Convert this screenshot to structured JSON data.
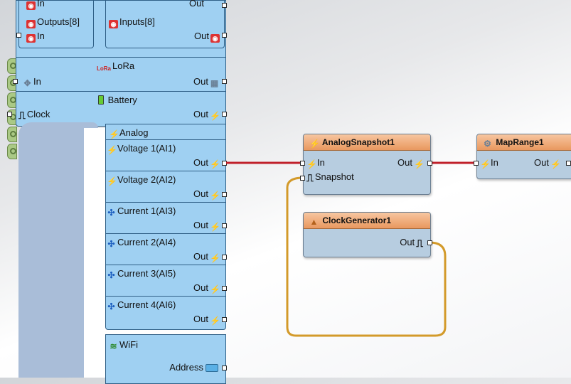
{
  "board": {
    "top_partial_left": "In",
    "top_partial_right": "Out",
    "outputs_label": "Outputs[8]",
    "outputs_in": "In",
    "inputs_label": "Inputs[8]",
    "inputs_out": "Out",
    "lora_label": "LoRa",
    "lora_icon_text": "LoRa",
    "lora_in": "In",
    "lora_out": "Out",
    "battery_label": "Battery",
    "clock_label": "Clock",
    "battery_out": "Out",
    "analog_label": "Analog",
    "analog_channels": [
      {
        "label": "Voltage 1(AI1)",
        "out": "Out",
        "icon": "voltage-icon"
      },
      {
        "label": "Voltage 2(AI2)",
        "out": "Out",
        "icon": "voltage-icon"
      },
      {
        "label": "Current 1(AI3)",
        "out": "Out",
        "icon": "current-icon"
      },
      {
        "label": "Current 2(AI4)",
        "out": "Out",
        "icon": "current-icon"
      },
      {
        "label": "Current 3(AI5)",
        "out": "Out",
        "icon": "current-icon"
      },
      {
        "label": "Current 4(AI6)",
        "out": "Out",
        "icon": "current-icon"
      }
    ],
    "wifi_label": "WiFi",
    "wifi_address": "Address"
  },
  "components": {
    "analog_snapshot": {
      "title": "AnalogSnapshot1",
      "in": "In",
      "out": "Out",
      "snapshot": "Snapshot"
    },
    "map_range": {
      "title": "MapRange1",
      "in": "In",
      "out": "Out"
    },
    "clock_generator": {
      "title": "ClockGenerator1",
      "out": "Out"
    }
  },
  "colors": {
    "panel": "#9fd0f2",
    "component_header": "#e9985f",
    "analog_wire": "#c0202a",
    "clock_wire": "#d39a2a"
  }
}
